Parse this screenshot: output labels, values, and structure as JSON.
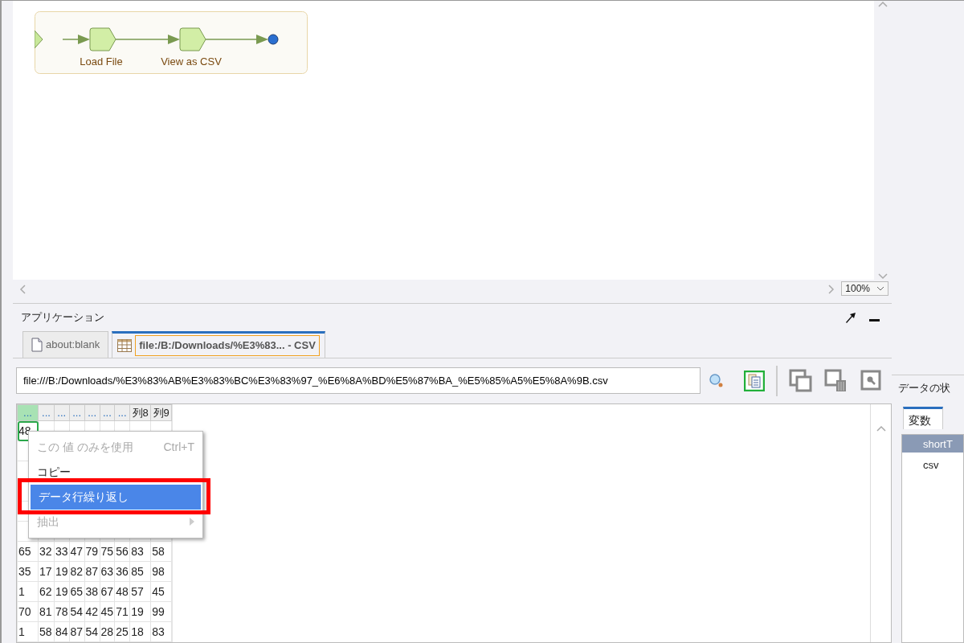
{
  "flow": {
    "nodes": [
      {
        "kind": "start"
      },
      {
        "kind": "task",
        "label": "Load File"
      },
      {
        "kind": "task",
        "label": "View as CSV"
      },
      {
        "kind": "end"
      }
    ]
  },
  "zoom": {
    "value": "100%"
  },
  "panel": {
    "title": "アプリケーション"
  },
  "tabs": [
    {
      "label": "about:blank",
      "kind": "page",
      "selected": false
    },
    {
      "label": "file:/B:/Downloads/%E3%83... - CSV",
      "kind": "table",
      "selected": true
    }
  ],
  "url": {
    "value": "file:///B:/Downloads/%E3%83%AB%E3%83%BC%E3%83%97_%E6%8A%BD%E5%87%BA_%E5%85%A5%E5%8A%9B.csv"
  },
  "grid": {
    "columns": [
      {
        "label": "...",
        "selected": true
      },
      {
        "label": "...",
        "selected": false
      },
      {
        "label": "...",
        "selected": false
      },
      {
        "label": "...",
        "selected": false
      },
      {
        "label": "...",
        "selected": false
      },
      {
        "label": "...",
        "selected": false
      },
      {
        "label": "...",
        "selected": false
      },
      {
        "label": "列8",
        "selected": false
      },
      {
        "label": "列9",
        "selected": false
      }
    ],
    "rows": [
      {
        "kind": "data",
        "cells": [
          "48"
        ]
      },
      {
        "kind": "hidden"
      },
      {
        "kind": "hidden"
      },
      {
        "kind": "hidden"
      },
      {
        "kind": "hidden"
      },
      {
        "kind": "hidden"
      },
      {
        "kind": "data",
        "cells": [
          "65",
          "32",
          "33",
          "47",
          "79",
          "75",
          "56",
          "83",
          "58"
        ]
      },
      {
        "kind": "data",
        "cells": [
          "35",
          "17",
          "19",
          "82",
          "87",
          "63",
          "36",
          "85",
          "98"
        ]
      },
      {
        "kind": "data",
        "cells": [
          "1",
          "62",
          "19",
          "65",
          "38",
          "67",
          "48",
          "57",
          "45"
        ]
      },
      {
        "kind": "data",
        "cells": [
          "70",
          "81",
          "78",
          "54",
          "42",
          "45",
          "71",
          "19",
          "99"
        ]
      },
      {
        "kind": "data",
        "cells": [
          "1",
          "58",
          "84",
          "87",
          "54",
          "28",
          "25",
          "18",
          "83"
        ]
      }
    ]
  },
  "context_menu": {
    "items": [
      {
        "label": "この 値 のみを使用",
        "shortcut": "Ctrl+T",
        "disabled": true,
        "selected": false,
        "submenu": false
      },
      {
        "label": "コピー",
        "disabled": false,
        "selected": false,
        "submenu": false
      },
      {
        "label": "データ行繰り返し",
        "disabled": false,
        "selected": true,
        "submenu": false
      },
      {
        "label": "抽出",
        "disabled": true,
        "selected": false,
        "submenu": true
      }
    ]
  },
  "side_panel": {
    "title": "データの状",
    "tabs": [
      {
        "label": "変数",
        "selected": true
      }
    ],
    "table": {
      "header": "shortT",
      "rows": [
        "csv"
      ]
    }
  }
}
